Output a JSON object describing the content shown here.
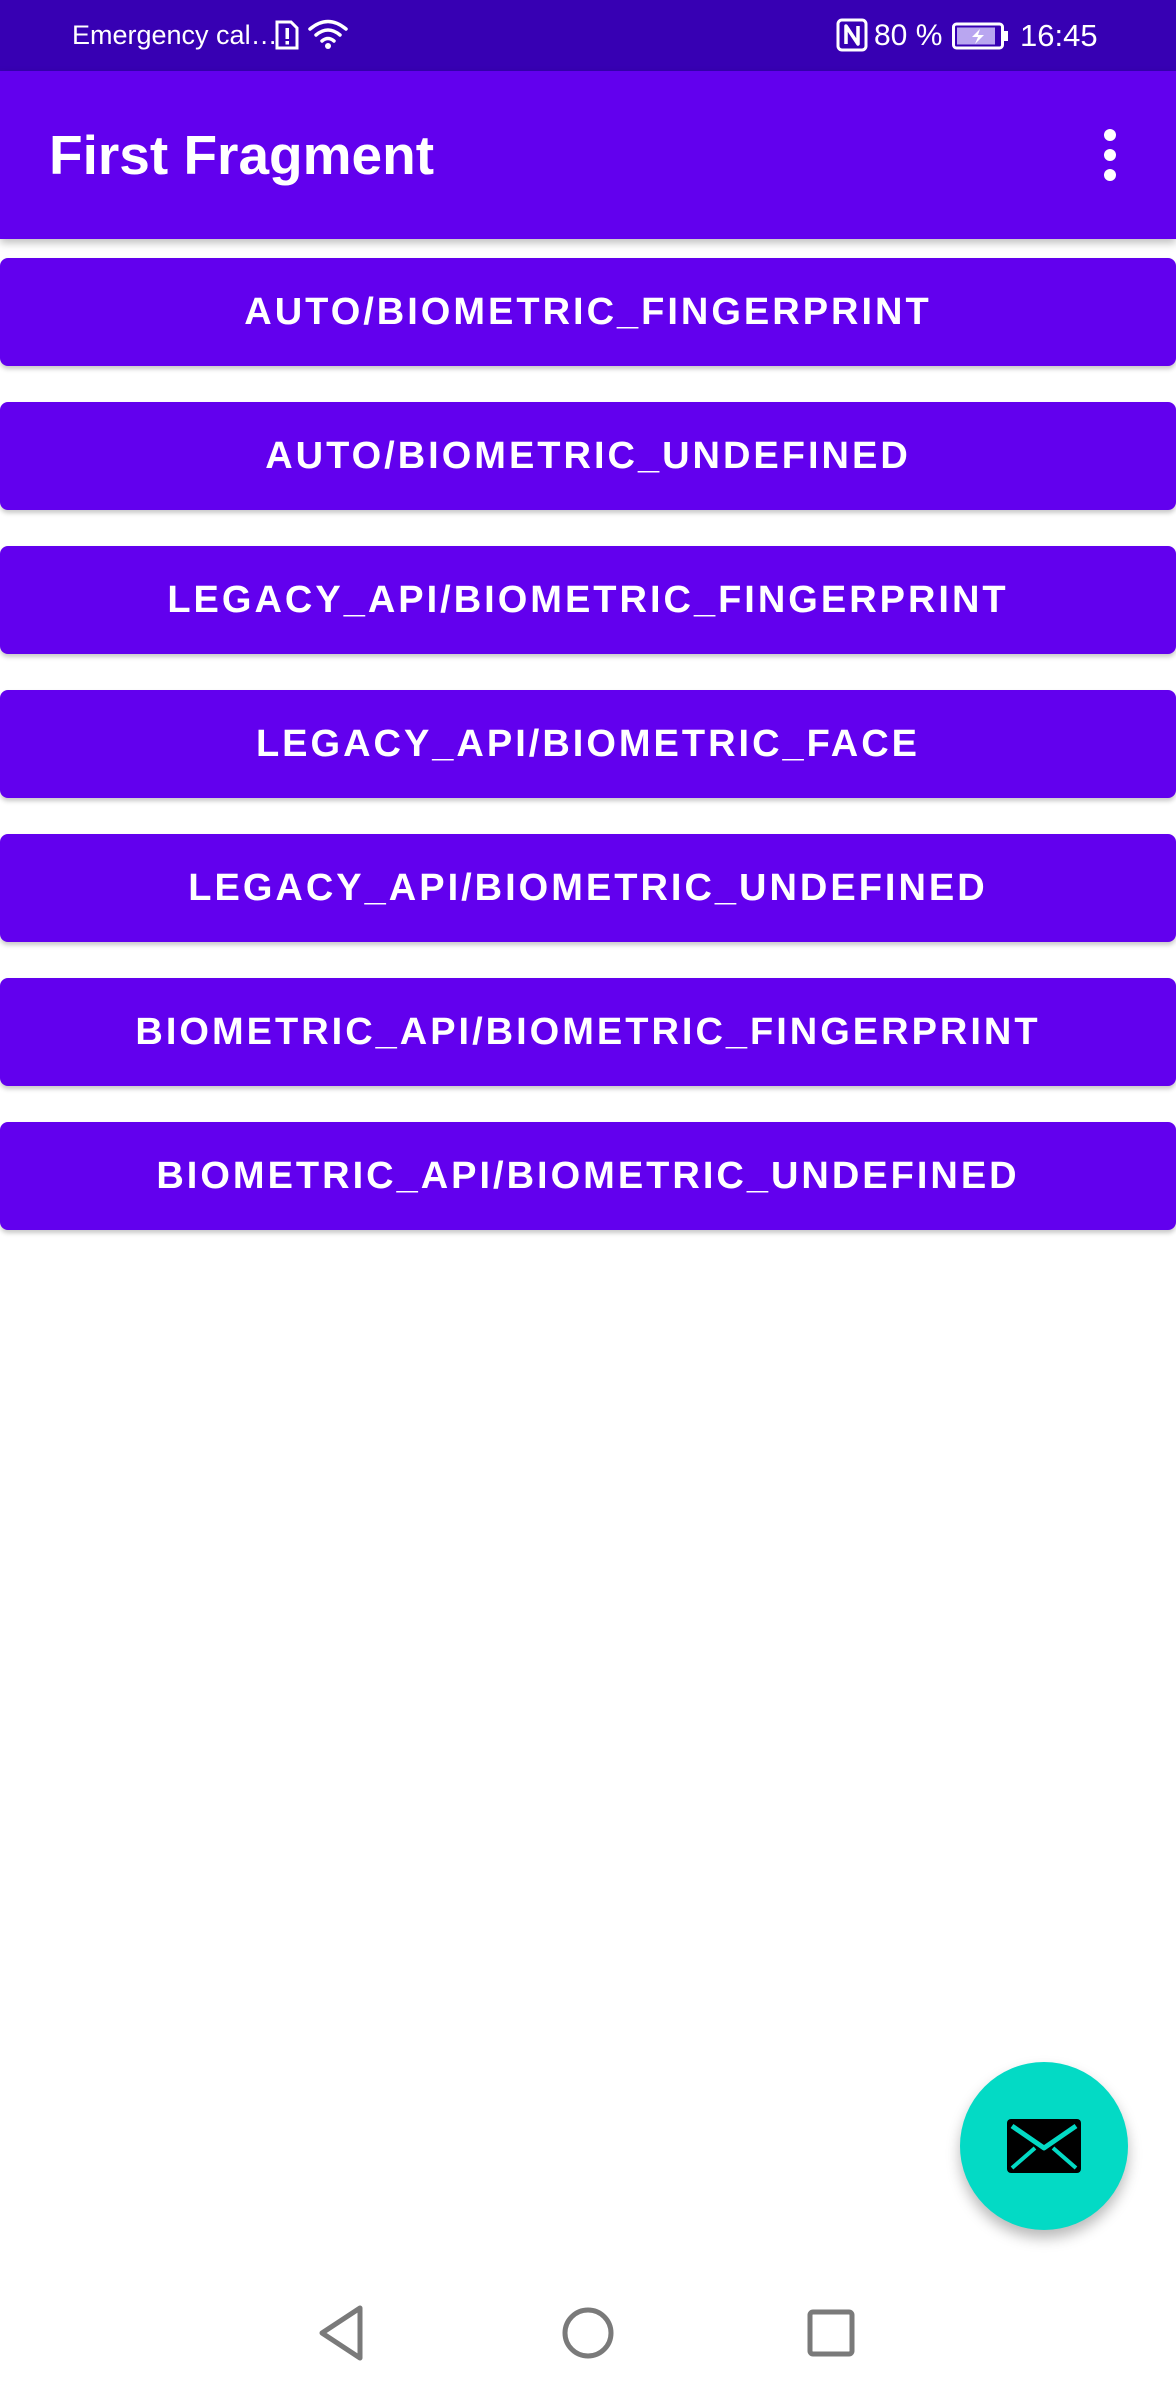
{
  "status_bar": {
    "carrier": "Emergency cal…",
    "battery": "80 %",
    "time": "16:45"
  },
  "app_bar": {
    "title": "First Fragment",
    "overflow_icon": "more-vert-icon"
  },
  "buttons": [
    {
      "label": "AUTO/BIOMETRIC_FINGERPRINT"
    },
    {
      "label": "AUTO/BIOMETRIC_UNDEFINED"
    },
    {
      "label": "LEGACY_API/BIOMETRIC_FINGERPRINT"
    },
    {
      "label": "LEGACY_API/BIOMETRIC_FACE"
    },
    {
      "label": "LEGACY_API/BIOMETRIC_UNDEFINED"
    },
    {
      "label": "BIOMETRIC_API/BIOMETRIC_FINGERPRINT"
    },
    {
      "label": "BIOMETRIC_API/BIOMETRIC_UNDEFINED"
    }
  ],
  "fab": {
    "icon": "email-icon"
  },
  "nav_bar": {
    "icons": [
      "back-icon",
      "home-icon",
      "recents-icon"
    ]
  },
  "colors": {
    "status_bar": "#3700B3",
    "primary": "#6200EE",
    "accent": "#03DAC5",
    "background": "#FFFFFF"
  }
}
